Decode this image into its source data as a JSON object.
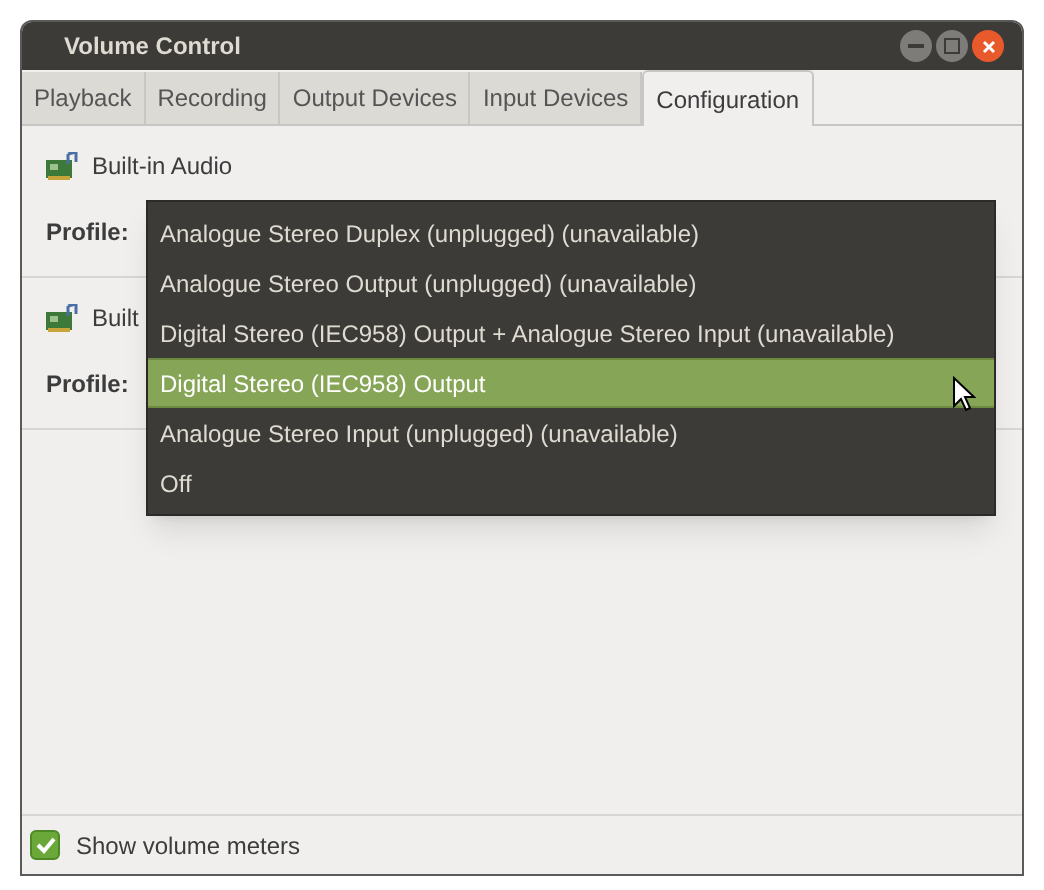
{
  "window": {
    "title": "Volume Control"
  },
  "tabs": [
    {
      "label": "Playback",
      "selected": false
    },
    {
      "label": "Recording",
      "selected": false
    },
    {
      "label": "Output Devices",
      "selected": false
    },
    {
      "label": "Input Devices",
      "selected": false
    },
    {
      "label": "Configuration",
      "selected": true
    }
  ],
  "devices": [
    {
      "name": "Built-in Audio",
      "profile_label": "Profile:"
    },
    {
      "name": "Built",
      "profile_label": "Profile:"
    }
  ],
  "profile_menu": [
    {
      "label": "Analogue Stereo Duplex (unplugged) (unavailable)",
      "selected": false
    },
    {
      "label": "Analogue Stereo Output (unplugged) (unavailable)",
      "selected": false
    },
    {
      "label": "Digital Stereo (IEC958) Output + Analogue Stereo Input (unavailable)",
      "selected": false
    },
    {
      "label": "Digital Stereo (IEC958) Output",
      "selected": true
    },
    {
      "label": "Analogue Stereo Input (unplugged) (unavailable)",
      "selected": false
    },
    {
      "label": "Off",
      "selected": false
    }
  ],
  "show_volume_meters": {
    "label": "Show volume meters",
    "checked": true
  }
}
